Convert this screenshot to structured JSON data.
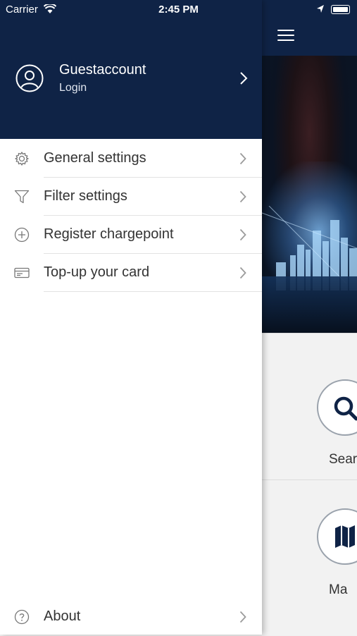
{
  "status_bar": {
    "carrier": "Carrier",
    "time": "2:45 PM"
  },
  "drawer": {
    "user": {
      "name": "Guestaccount",
      "action": "Login",
      "icon": "user-circle-icon"
    },
    "menu": [
      {
        "label": "General settings",
        "icon": "gear-icon"
      },
      {
        "label": "Filter settings",
        "icon": "filter-icon"
      },
      {
        "label": "Register chargepoint",
        "icon": "plus-circle-icon"
      },
      {
        "label": "Top-up your card",
        "icon": "card-icon"
      }
    ],
    "about": {
      "label": "About",
      "icon": "question-circle-icon"
    }
  },
  "background": {
    "tiles": [
      {
        "label": "Sear",
        "icon": "search-icon"
      },
      {
        "label": "Ma",
        "icon": "map-icon"
      }
    ]
  },
  "colors": {
    "header_bg": "#0f2346",
    "text": "#333333",
    "divider": "#e3e3e3"
  }
}
